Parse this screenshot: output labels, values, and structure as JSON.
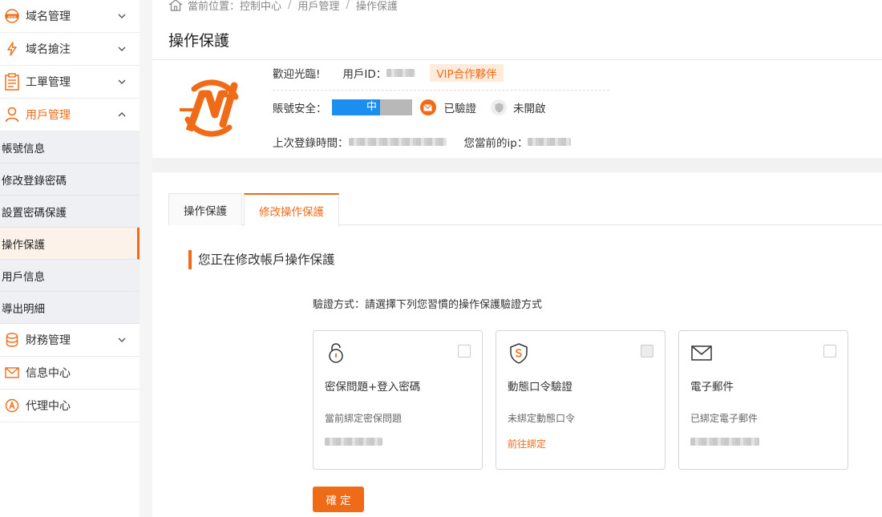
{
  "sidebar": {
    "groups": [
      {
        "label": "域名管理",
        "icon": "www-icon",
        "expanded": false
      },
      {
        "label": "域名搶注",
        "icon": "lightning-icon",
        "expanded": false
      },
      {
        "label": "工單管理",
        "icon": "clipboard-icon",
        "expanded": false
      },
      {
        "label": "用戶管理",
        "icon": "user-icon",
        "expanded": true
      }
    ],
    "sub_items": [
      "帳號信息",
      "修改登錄密碼",
      "設置密碼保護",
      "操作保護",
      "用戶信息",
      "導出明細"
    ],
    "current_sub": "操作保護",
    "bottom_groups": [
      {
        "label": "財務管理",
        "icon": "coins-icon"
      },
      {
        "label": "信息中心",
        "icon": "mail-icon"
      },
      {
        "label": "代理中心",
        "icon": "agent-icon"
      }
    ]
  },
  "breadcrumb": {
    "prefix": "當前位置：",
    "items": [
      "控制中心",
      "用戶管理",
      "操作保護"
    ],
    "sep": "/"
  },
  "page_title": "操作保護",
  "profile": {
    "welcome": "歡迎光臨!",
    "uid_label": "用戶ID：",
    "vip": "VIP合作夥伴",
    "security_label": "賬號安全：",
    "security_level": "中",
    "security_fraction": 0.6,
    "email_status": "已驗證",
    "shield_status": "未開啟",
    "last_login_label": "上次登錄時間：",
    "ip_label": "您當前的ip："
  },
  "tabs": [
    "操作保護",
    "修改操作保護"
  ],
  "active_tab": 1,
  "section_title": "您正在修改帳戶操作保護",
  "verify_tip": "驗證方式：請選擇下列您習慣的操作保護驗證方式",
  "cards": [
    {
      "title": "密保問題+登入密碼",
      "desc": "當前綁定密保問題",
      "icon": "lock-icon"
    },
    {
      "title": "動態口令驗證",
      "desc": "未綁定動態口令",
      "link": "前往綁定",
      "icon": "shield-s-icon"
    },
    {
      "title": "電子郵件",
      "desc": "已綁定電子郵件",
      "icon": "envelope-icon"
    }
  ],
  "confirm_label": "確定",
  "colors": {
    "accent": "#f06b17",
    "bar_fill": "#1c8ef0"
  }
}
